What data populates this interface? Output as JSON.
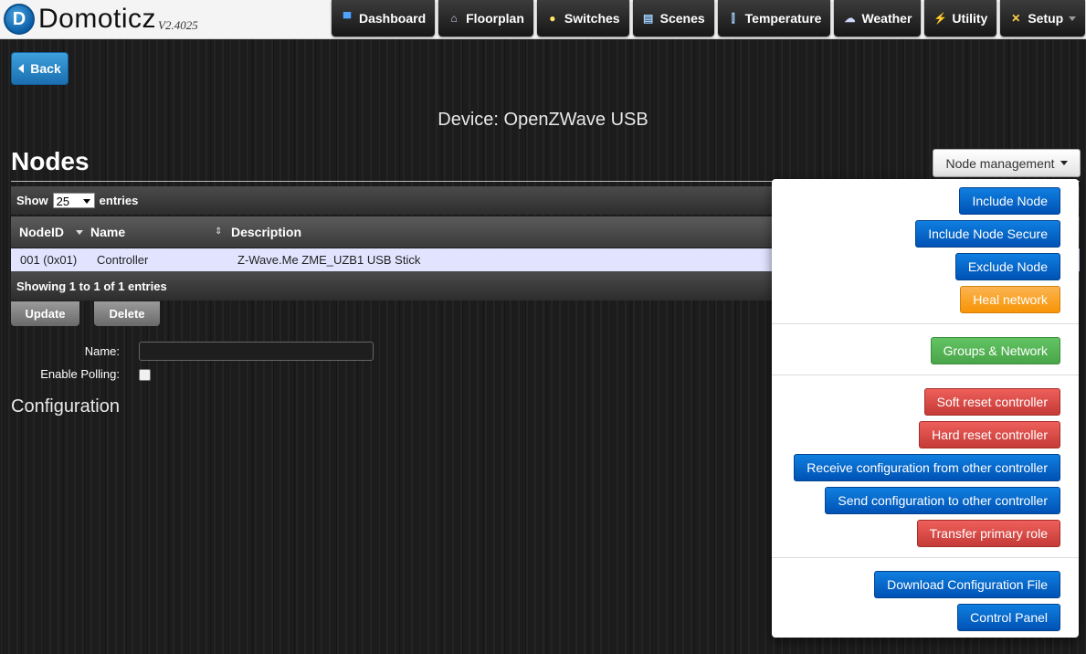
{
  "app": {
    "name": "Domoticz",
    "version": "V2.4025",
    "logo_glyph": "D"
  },
  "nav": [
    {
      "label": "Dashboard",
      "icon": "monitor-icon",
      "glyph": "▀",
      "color": "#4da3ff"
    },
    {
      "label": "Floorplan",
      "icon": "house-icon",
      "glyph": "⌂",
      "color": "#d8d8ff"
    },
    {
      "label": "Switches",
      "icon": "bulb-icon",
      "glyph": "●",
      "color": "#ffe566"
    },
    {
      "label": "Scenes",
      "icon": "clapper-icon",
      "glyph": "▤",
      "color": "#9fd0ff"
    },
    {
      "label": "Temperature",
      "icon": "thermometer-icon",
      "glyph": "⫿",
      "color": "#9fd0ff"
    },
    {
      "label": "Weather",
      "icon": "cloud-icon",
      "glyph": "☁",
      "color": "#d0d8ff"
    },
    {
      "label": "Utility",
      "icon": "bolt-icon",
      "glyph": "⚡",
      "color": "#ffe066"
    },
    {
      "label": "Setup",
      "icon": "tools-icon",
      "glyph": "✕",
      "color": "#ffd24d",
      "has_caret": true
    }
  ],
  "back_label": "Back",
  "device_title": "Device: OpenZWave USB",
  "nodes_title": "Nodes",
  "node_management_label": "Node management",
  "table": {
    "show_label": "Show",
    "entries_value": "25",
    "entries_label": "entries",
    "columns": [
      "NodeID",
      "Name",
      "Description"
    ],
    "rows": [
      {
        "nodeid": "001 (0x01)",
        "name": "Controller",
        "description": "Z-Wave.Me ZME_UZB1 USB Stick"
      }
    ],
    "footer": "Showing 1 to 1 of 1 entries"
  },
  "actions": {
    "update": "Update",
    "delete": "Delete"
  },
  "form": {
    "name_label": "Name:",
    "name_value": "",
    "polling_label": "Enable Polling:",
    "polling_checked": false
  },
  "config_title": "Configuration",
  "menu": {
    "include_node": "Include Node",
    "include_node_secure": "Include Node Secure",
    "exclude_node": "Exclude Node",
    "heal_network": "Heal network",
    "groups_network": "Groups & Network",
    "soft_reset": "Soft reset controller",
    "hard_reset": "Hard reset controller",
    "receive_config": "Receive configuration from other controller",
    "send_config": "Send configuration to other controller",
    "transfer_primary": "Transfer primary role",
    "download_config": "Download Configuration File",
    "control_panel": "Control Panel"
  }
}
